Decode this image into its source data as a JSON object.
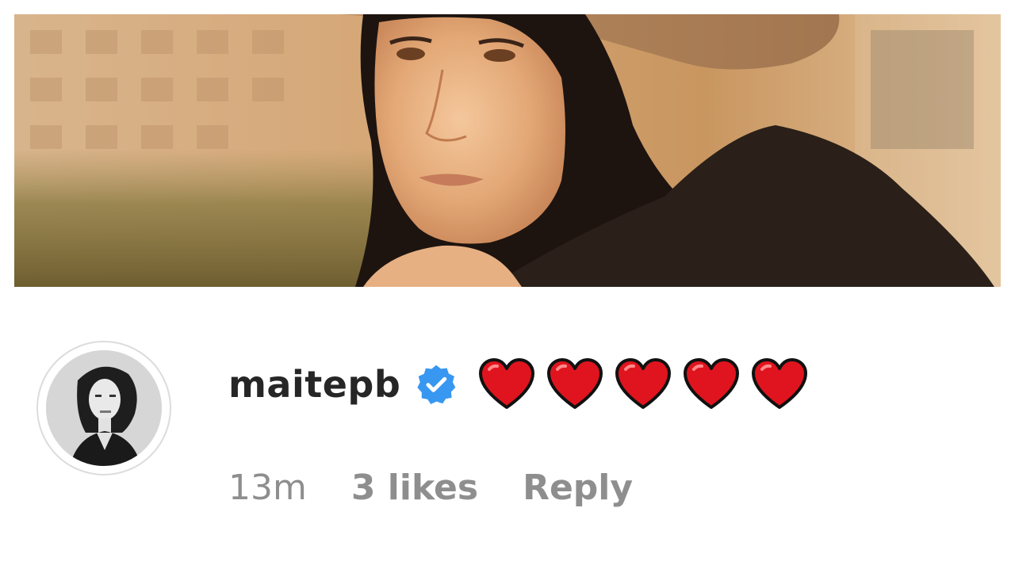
{
  "post": {
    "photo_description_icon": "photo-image"
  },
  "comment": {
    "avatar_icon": "profile-avatar",
    "username": "maitepb",
    "verified_icon": "verified-badge-icon",
    "text_emoji": [
      "❤️",
      "❤️",
      "❤️",
      "❤️",
      "❤️"
    ],
    "time": "13m",
    "likes": "3 likes",
    "reply_label": "Reply"
  },
  "colors": {
    "username": "#262626",
    "meta": "#8e8e8e",
    "verified_blue": "#3897f0",
    "heart_red": "#e0141e"
  }
}
